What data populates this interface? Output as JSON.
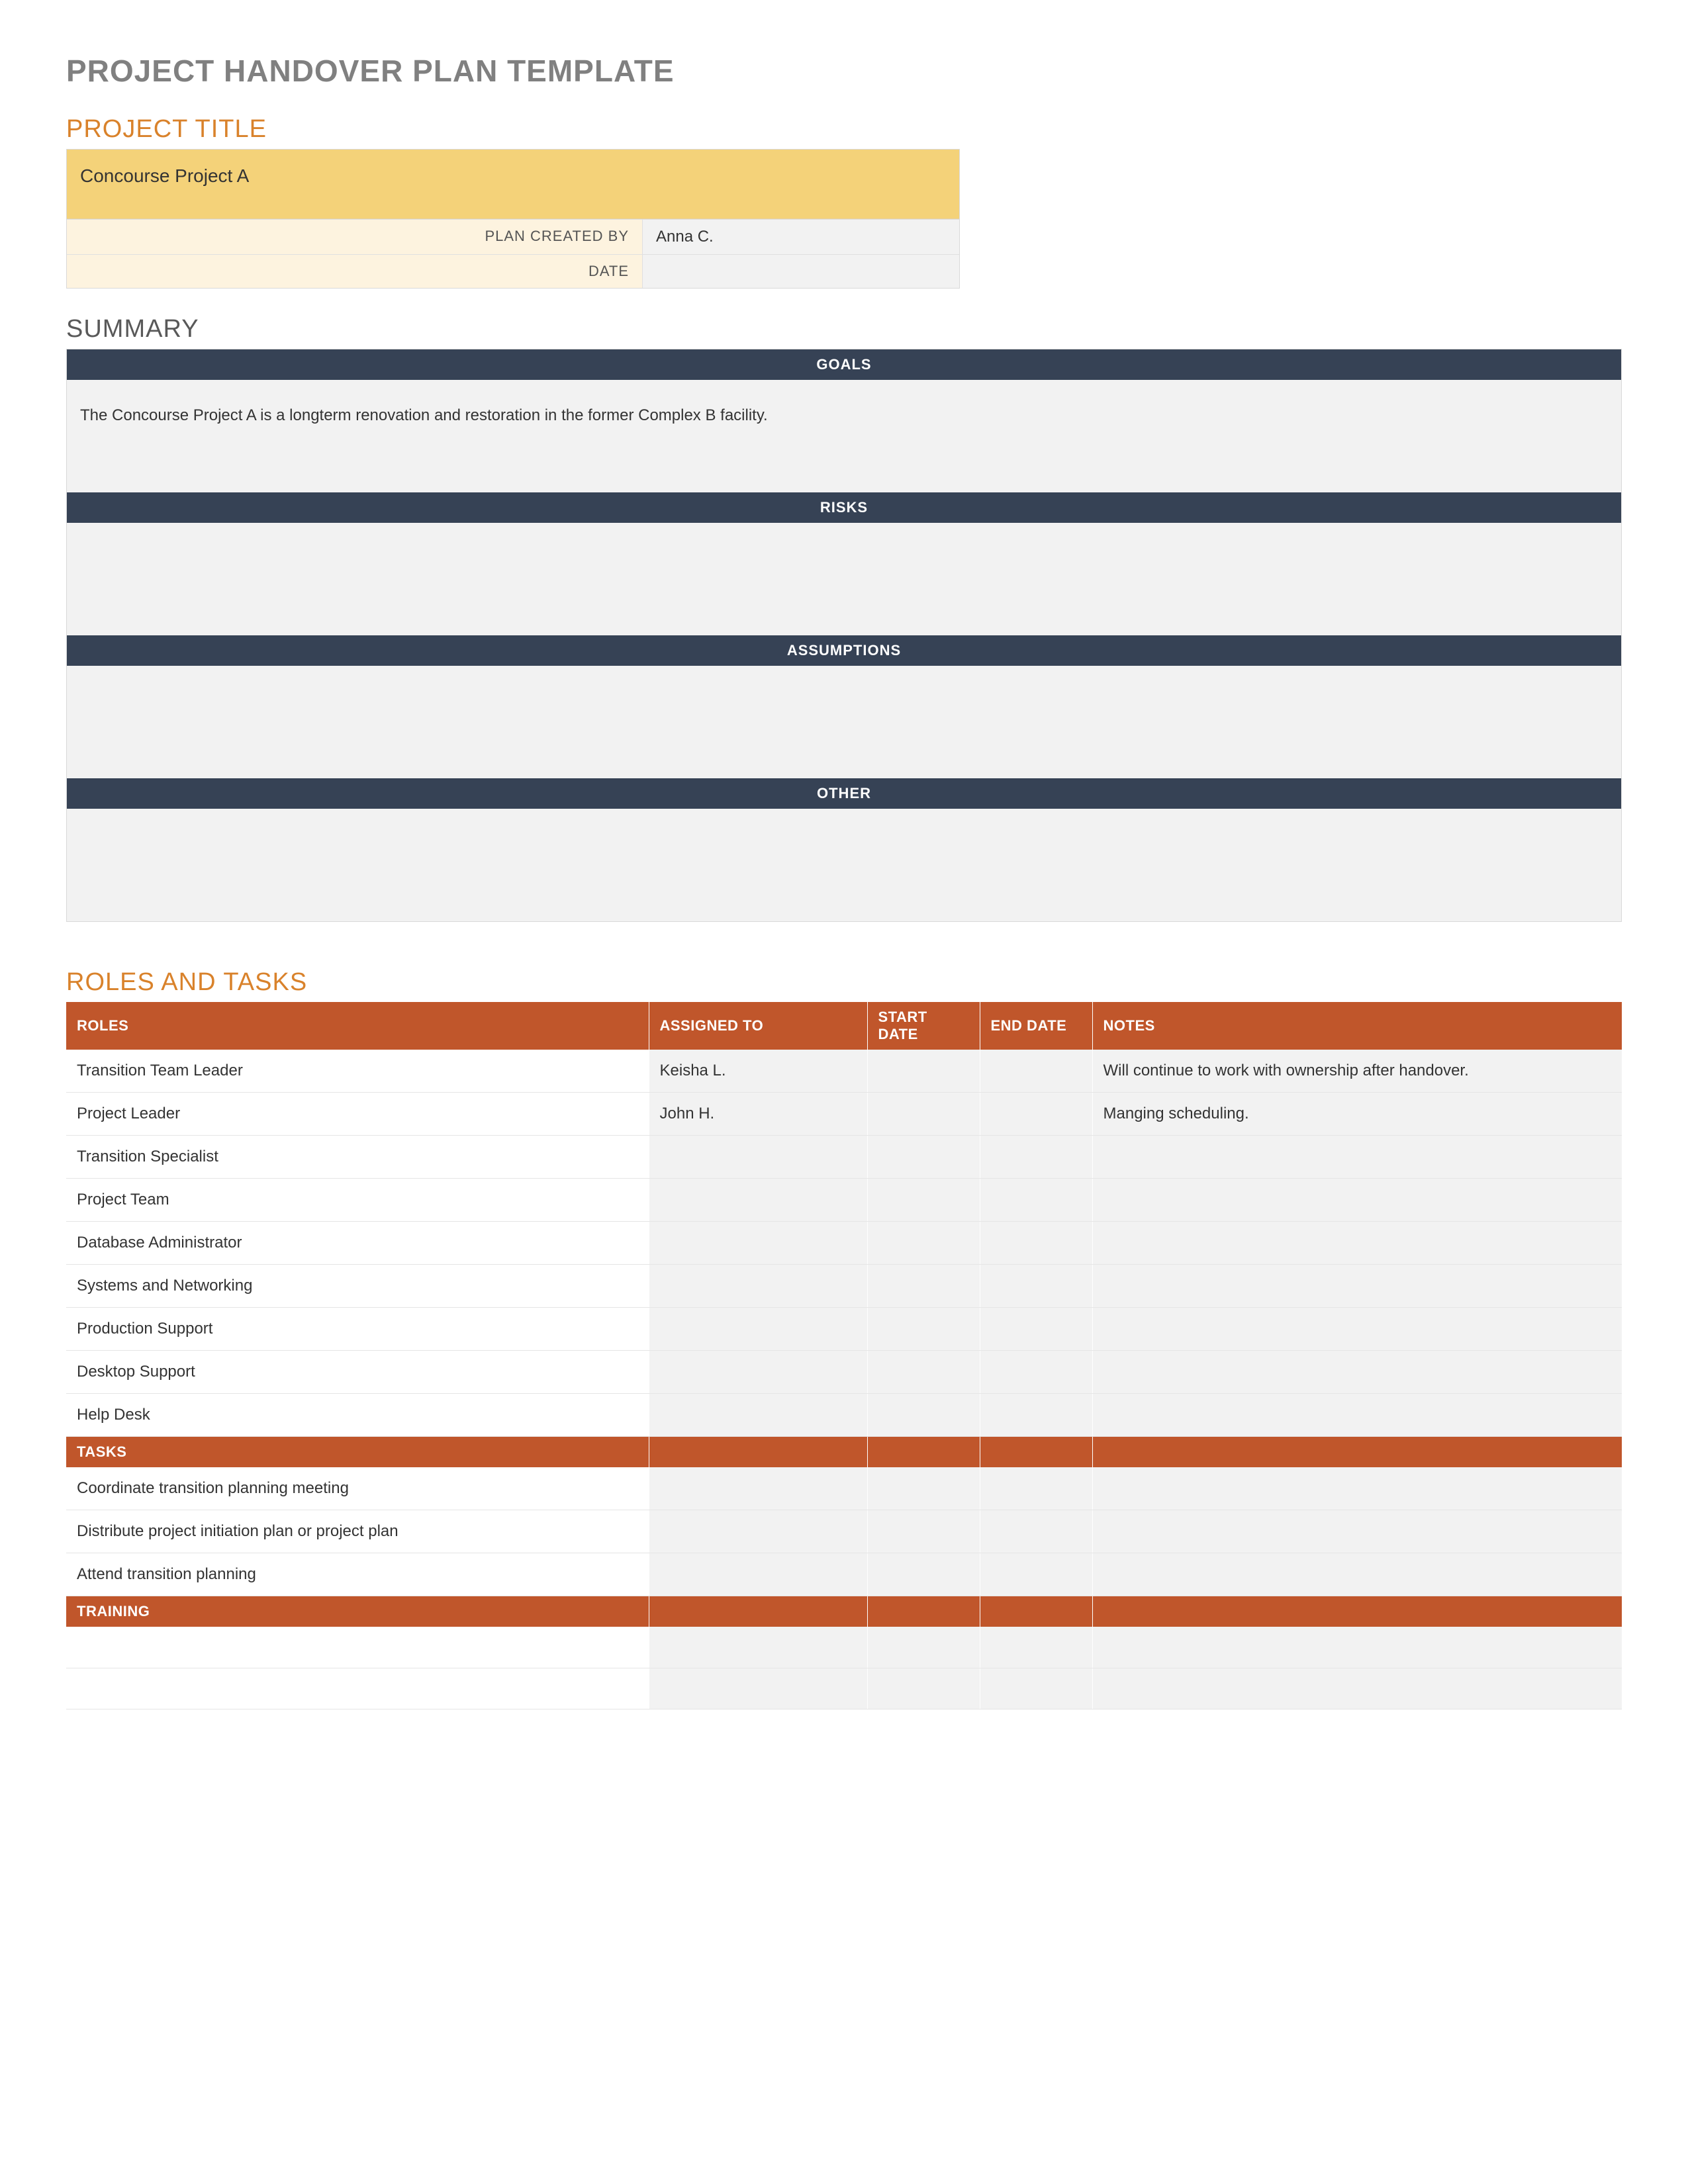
{
  "doc_title": "PROJECT HANDOVER PLAN TEMPLATE",
  "project_title_section": {
    "heading": "PROJECT TITLE",
    "project_name": "Concourse Project A",
    "rows": [
      {
        "label": "PLAN CREATED BY",
        "value": "Anna C."
      },
      {
        "label": "DATE",
        "value": ""
      }
    ]
  },
  "summary": {
    "heading": "SUMMARY",
    "blocks": [
      {
        "title": "GOALS",
        "body": "The Concourse Project A is a longterm renovation and restoration in the former Complex B facility."
      },
      {
        "title": "RISKS",
        "body": ""
      },
      {
        "title": "ASSUMPTIONS",
        "body": ""
      },
      {
        "title": "OTHER",
        "body": ""
      }
    ]
  },
  "roles_tasks": {
    "heading": "ROLES AND TASKS",
    "columns": [
      "ROLES",
      "ASSIGNED TO",
      "START DATE",
      "END DATE",
      "NOTES"
    ],
    "roles_rows": [
      {
        "role": "Transition Team Leader",
        "assigned": "Keisha L.",
        "start": "",
        "end": "",
        "notes": "Will continue to work with ownership after handover."
      },
      {
        "role": "Project Leader",
        "assigned": "John H.",
        "start": "",
        "end": "",
        "notes": "Manging scheduling."
      },
      {
        "role": "Transition Specialist",
        "assigned": "",
        "start": "",
        "end": "",
        "notes": ""
      },
      {
        "role": "Project Team",
        "assigned": "",
        "start": "",
        "end": "",
        "notes": ""
      },
      {
        "role": "Database Administrator",
        "assigned": "",
        "start": "",
        "end": "",
        "notes": ""
      },
      {
        "role": "Systems and Networking",
        "assigned": "",
        "start": "",
        "end": "",
        "notes": ""
      },
      {
        "role": "Production Support",
        "assigned": "",
        "start": "",
        "end": "",
        "notes": ""
      },
      {
        "role": "Desktop Support",
        "assigned": "",
        "start": "",
        "end": "",
        "notes": ""
      },
      {
        "role": "Help Desk",
        "assigned": "",
        "start": "",
        "end": "",
        "notes": ""
      }
    ],
    "tasks_label": "TASKS",
    "tasks_rows": [
      {
        "role": "Coordinate transition planning meeting",
        "assigned": "",
        "start": "",
        "end": "",
        "notes": ""
      },
      {
        "role": "Distribute project initiation plan or project plan",
        "assigned": "",
        "start": "",
        "end": "",
        "notes": ""
      },
      {
        "role": "Attend transition planning",
        "assigned": "",
        "start": "",
        "end": "",
        "notes": ""
      }
    ],
    "training_label": "TRAINING",
    "training_rows": [
      {
        "role": "",
        "assigned": "",
        "start": "",
        "end": "",
        "notes": ""
      },
      {
        "role": "",
        "assigned": "",
        "start": "",
        "end": "",
        "notes": ""
      }
    ]
  }
}
